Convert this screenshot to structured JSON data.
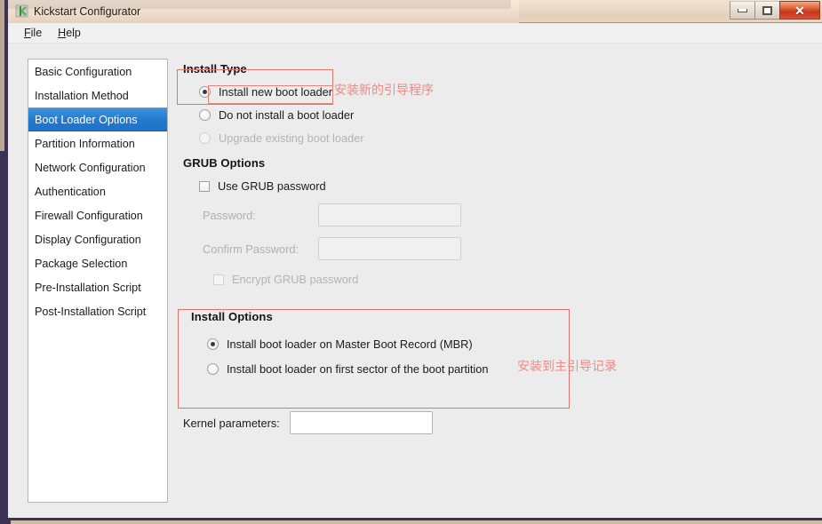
{
  "window": {
    "title": "Kickstart Configurator",
    "icon": "kickstart-icon",
    "controls": {
      "minimize": "minimize-icon",
      "maximize": "restore-icon",
      "close": "✕"
    }
  },
  "menubar": {
    "items": [
      {
        "label": "File",
        "mnemonic": "F",
        "rest": "ile"
      },
      {
        "label": "Help",
        "mnemonic": "H",
        "rest": "elp"
      }
    ]
  },
  "sidebar": {
    "selected_index": 2,
    "items": [
      {
        "label": "Basic Configuration"
      },
      {
        "label": "Installation Method"
      },
      {
        "label": "Boot Loader Options"
      },
      {
        "label": "Partition Information"
      },
      {
        "label": "Network Configuration"
      },
      {
        "label": "Authentication"
      },
      {
        "label": "Firewall Configuration"
      },
      {
        "label": "Display Configuration"
      },
      {
        "label": "Package Selection"
      },
      {
        "label": "Pre-Installation Script"
      },
      {
        "label": "Post-Installation Script"
      }
    ]
  },
  "install_type": {
    "title": "Install Type",
    "options": [
      {
        "label": "Install new boot loader",
        "selected": true,
        "enabled": true
      },
      {
        "label": "Do not install a boot loader",
        "selected": false,
        "enabled": true
      },
      {
        "label": "Upgrade existing boot loader",
        "selected": false,
        "enabled": false
      }
    ]
  },
  "grub_options": {
    "title": "GRUB Options",
    "use_grub_password": {
      "label": "Use GRUB password",
      "checked": false
    },
    "password": {
      "label": "Password:",
      "value": "",
      "placeholder": "",
      "enabled": false
    },
    "confirm_password": {
      "label": "Confirm Password:",
      "value": "",
      "placeholder": "",
      "enabled": false
    },
    "encrypt": {
      "label": "Encrypt GRUB password",
      "checked": false,
      "enabled": false
    }
  },
  "install_options": {
    "title": "Install Options",
    "options": [
      {
        "label": "Install boot loader on Master Boot Record (MBR)",
        "selected": true
      },
      {
        "label": "Install boot loader on first sector of the boot partition",
        "selected": false
      }
    ]
  },
  "kernel_parameters": {
    "label": "Kernel parameters:",
    "value": "",
    "placeholder": ""
  },
  "annotations": {
    "color": "#ef8a84",
    "items": [
      {
        "text": "安装新的引导程序",
        "target": "install-new-boot-loader"
      },
      {
        "text": "安装到主引导记录",
        "target": "install-options-mbr"
      }
    ]
  },
  "colors": {
    "selection_blue": "#2279cf",
    "titlebar_tan": "#ecd9c6",
    "close_red": "#c8351a",
    "window_border": "#3a3250",
    "panel_gray": "#ececec",
    "annotation_red": "#ef8a84"
  }
}
